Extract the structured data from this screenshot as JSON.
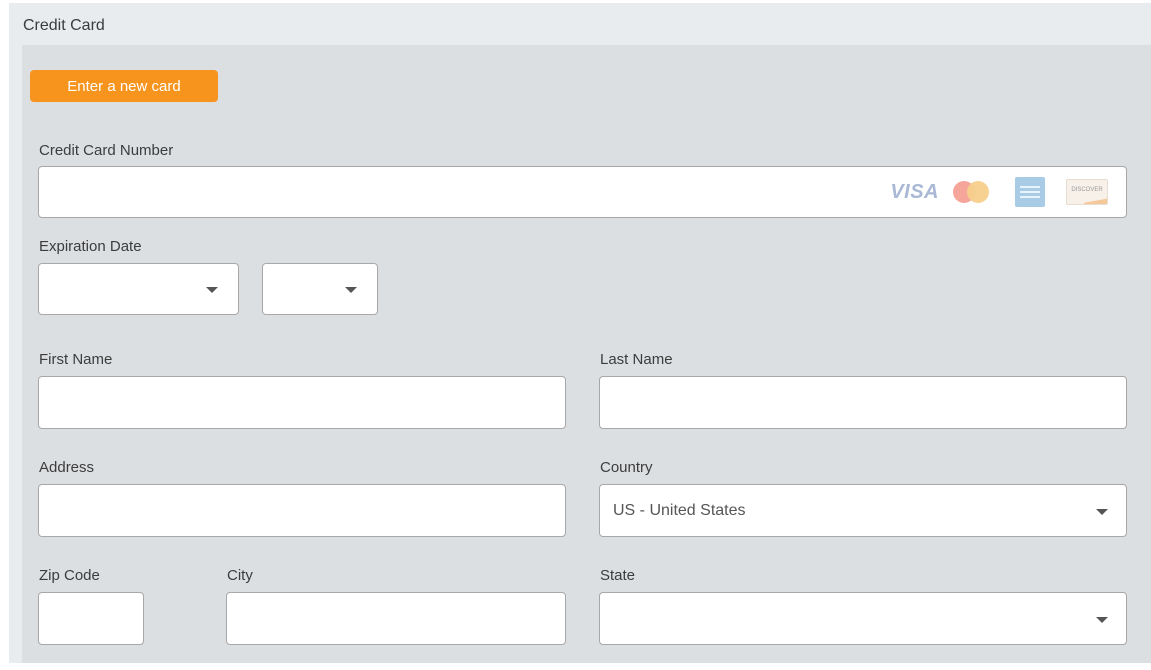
{
  "section": {
    "title": "Credit Card"
  },
  "new_card_button": {
    "label": "Enter a new card"
  },
  "card_number": {
    "label": "Credit Card Number",
    "value": "",
    "logos": {
      "visa": "VISA",
      "discover": "DISCOVER"
    }
  },
  "expiration": {
    "label": "Expiration Date",
    "month_value": "",
    "year_value": ""
  },
  "first_name": {
    "label": "First Name",
    "value": ""
  },
  "last_name": {
    "label": "Last Name",
    "value": ""
  },
  "address": {
    "label": "Address",
    "value": ""
  },
  "country": {
    "label": "Country",
    "value": "US - United States"
  },
  "zip_code": {
    "label": "Zip Code",
    "value": ""
  },
  "city": {
    "label": "City",
    "value": ""
  },
  "state": {
    "label": "State",
    "value": ""
  },
  "colors": {
    "accent": "#f7941d",
    "panel": "#e8ecef",
    "panel_body": "#dcdfe2",
    "field_border": "#a8a8a8"
  },
  "icons": [
    "caret-down-icon",
    "visa-icon",
    "mastercard-icon",
    "amex-icon",
    "discover-icon"
  ]
}
